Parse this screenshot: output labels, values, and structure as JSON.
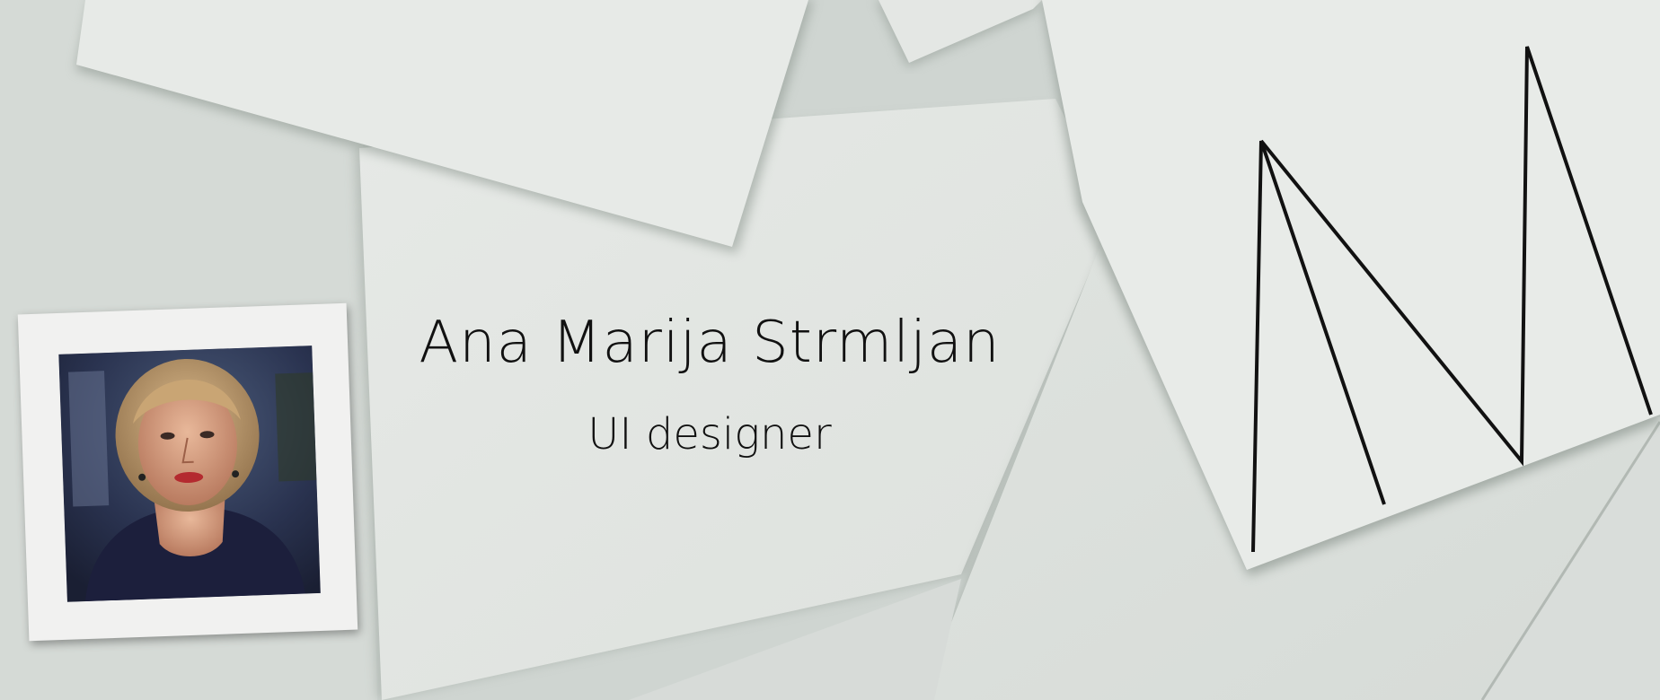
{
  "hero": {
    "name": "Ana Marija Strmljan",
    "role": "UI designer"
  },
  "logo": {
    "icon": "monogram-zigzag-icon",
    "stroke_color": "#111111"
  },
  "photo": {
    "icon": "portrait-photo",
    "frame_color": "#f1f1f0"
  },
  "colors": {
    "background": "#d3d8d4",
    "paper": "#e3e6e3",
    "shadow": "#9aa39c",
    "text": "#111111"
  }
}
